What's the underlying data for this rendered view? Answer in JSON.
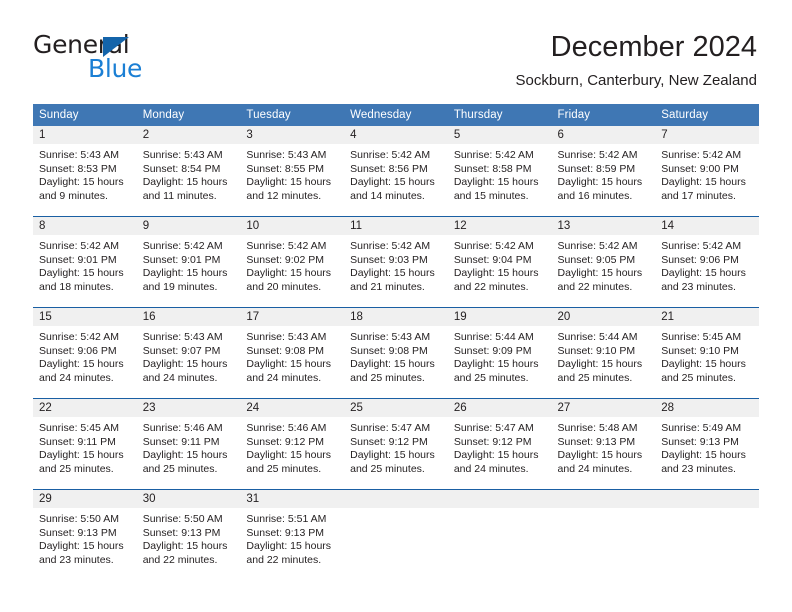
{
  "brand": {
    "name_part1": "General",
    "name_part2": "Blue",
    "logo_triangle": "blue-triangle-icon",
    "accent_color": "#1b7fd4",
    "dark_color": "#231f20"
  },
  "header": {
    "title": "December 2024",
    "subtitle": "Sockburn, Canterbury, New Zealand"
  },
  "calendar": {
    "header_bg_color": "#3f77b4",
    "row_rule_color": "#1a5fa3",
    "daynum_bg_color": "#f0f0f0",
    "weekday_headers": [
      "Sunday",
      "Monday",
      "Tuesday",
      "Wednesday",
      "Thursday",
      "Friday",
      "Saturday"
    ],
    "weeks": [
      [
        {
          "day": "1",
          "sunrise": "Sunrise: 5:43 AM",
          "sunset": "Sunset: 8:53 PM",
          "daylight_line1": "Daylight: 15 hours",
          "daylight_line2": "and 9 minutes."
        },
        {
          "day": "2",
          "sunrise": "Sunrise: 5:43 AM",
          "sunset": "Sunset: 8:54 PM",
          "daylight_line1": "Daylight: 15 hours",
          "daylight_line2": "and 11 minutes."
        },
        {
          "day": "3",
          "sunrise": "Sunrise: 5:43 AM",
          "sunset": "Sunset: 8:55 PM",
          "daylight_line1": "Daylight: 15 hours",
          "daylight_line2": "and 12 minutes."
        },
        {
          "day": "4",
          "sunrise": "Sunrise: 5:42 AM",
          "sunset": "Sunset: 8:56 PM",
          "daylight_line1": "Daylight: 15 hours",
          "daylight_line2": "and 14 minutes."
        },
        {
          "day": "5",
          "sunrise": "Sunrise: 5:42 AM",
          "sunset": "Sunset: 8:58 PM",
          "daylight_line1": "Daylight: 15 hours",
          "daylight_line2": "and 15 minutes."
        },
        {
          "day": "6",
          "sunrise": "Sunrise: 5:42 AM",
          "sunset": "Sunset: 8:59 PM",
          "daylight_line1": "Daylight: 15 hours",
          "daylight_line2": "and 16 minutes."
        },
        {
          "day": "7",
          "sunrise": "Sunrise: 5:42 AM",
          "sunset": "Sunset: 9:00 PM",
          "daylight_line1": "Daylight: 15 hours",
          "daylight_line2": "and 17 minutes."
        }
      ],
      [
        {
          "day": "8",
          "sunrise": "Sunrise: 5:42 AM",
          "sunset": "Sunset: 9:01 PM",
          "daylight_line1": "Daylight: 15 hours",
          "daylight_line2": "and 18 minutes."
        },
        {
          "day": "9",
          "sunrise": "Sunrise: 5:42 AM",
          "sunset": "Sunset: 9:01 PM",
          "daylight_line1": "Daylight: 15 hours",
          "daylight_line2": "and 19 minutes."
        },
        {
          "day": "10",
          "sunrise": "Sunrise: 5:42 AM",
          "sunset": "Sunset: 9:02 PM",
          "daylight_line1": "Daylight: 15 hours",
          "daylight_line2": "and 20 minutes."
        },
        {
          "day": "11",
          "sunrise": "Sunrise: 5:42 AM",
          "sunset": "Sunset: 9:03 PM",
          "daylight_line1": "Daylight: 15 hours",
          "daylight_line2": "and 21 minutes."
        },
        {
          "day": "12",
          "sunrise": "Sunrise: 5:42 AM",
          "sunset": "Sunset: 9:04 PM",
          "daylight_line1": "Daylight: 15 hours",
          "daylight_line2": "and 22 minutes."
        },
        {
          "day": "13",
          "sunrise": "Sunrise: 5:42 AM",
          "sunset": "Sunset: 9:05 PM",
          "daylight_line1": "Daylight: 15 hours",
          "daylight_line2": "and 22 minutes."
        },
        {
          "day": "14",
          "sunrise": "Sunrise: 5:42 AM",
          "sunset": "Sunset: 9:06 PM",
          "daylight_line1": "Daylight: 15 hours",
          "daylight_line2": "and 23 minutes."
        }
      ],
      [
        {
          "day": "15",
          "sunrise": "Sunrise: 5:42 AM",
          "sunset": "Sunset: 9:06 PM",
          "daylight_line1": "Daylight: 15 hours",
          "daylight_line2": "and 24 minutes."
        },
        {
          "day": "16",
          "sunrise": "Sunrise: 5:43 AM",
          "sunset": "Sunset: 9:07 PM",
          "daylight_line1": "Daylight: 15 hours",
          "daylight_line2": "and 24 minutes."
        },
        {
          "day": "17",
          "sunrise": "Sunrise: 5:43 AM",
          "sunset": "Sunset: 9:08 PM",
          "daylight_line1": "Daylight: 15 hours",
          "daylight_line2": "and 24 minutes."
        },
        {
          "day": "18",
          "sunrise": "Sunrise: 5:43 AM",
          "sunset": "Sunset: 9:08 PM",
          "daylight_line1": "Daylight: 15 hours",
          "daylight_line2": "and 25 minutes."
        },
        {
          "day": "19",
          "sunrise": "Sunrise: 5:44 AM",
          "sunset": "Sunset: 9:09 PM",
          "daylight_line1": "Daylight: 15 hours",
          "daylight_line2": "and 25 minutes."
        },
        {
          "day": "20",
          "sunrise": "Sunrise: 5:44 AM",
          "sunset": "Sunset: 9:10 PM",
          "daylight_line1": "Daylight: 15 hours",
          "daylight_line2": "and 25 minutes."
        },
        {
          "day": "21",
          "sunrise": "Sunrise: 5:45 AM",
          "sunset": "Sunset: 9:10 PM",
          "daylight_line1": "Daylight: 15 hours",
          "daylight_line2": "and 25 minutes."
        }
      ],
      [
        {
          "day": "22",
          "sunrise": "Sunrise: 5:45 AM",
          "sunset": "Sunset: 9:11 PM",
          "daylight_line1": "Daylight: 15 hours",
          "daylight_line2": "and 25 minutes."
        },
        {
          "day": "23",
          "sunrise": "Sunrise: 5:46 AM",
          "sunset": "Sunset: 9:11 PM",
          "daylight_line1": "Daylight: 15 hours",
          "daylight_line2": "and 25 minutes."
        },
        {
          "day": "24",
          "sunrise": "Sunrise: 5:46 AM",
          "sunset": "Sunset: 9:12 PM",
          "daylight_line1": "Daylight: 15 hours",
          "daylight_line2": "and 25 minutes."
        },
        {
          "day": "25",
          "sunrise": "Sunrise: 5:47 AM",
          "sunset": "Sunset: 9:12 PM",
          "daylight_line1": "Daylight: 15 hours",
          "daylight_line2": "and 25 minutes."
        },
        {
          "day": "26",
          "sunrise": "Sunrise: 5:47 AM",
          "sunset": "Sunset: 9:12 PM",
          "daylight_line1": "Daylight: 15 hours",
          "daylight_line2": "and 24 minutes."
        },
        {
          "day": "27",
          "sunrise": "Sunrise: 5:48 AM",
          "sunset": "Sunset: 9:13 PM",
          "daylight_line1": "Daylight: 15 hours",
          "daylight_line2": "and 24 minutes."
        },
        {
          "day": "28",
          "sunrise": "Sunrise: 5:49 AM",
          "sunset": "Sunset: 9:13 PM",
          "daylight_line1": "Daylight: 15 hours",
          "daylight_line2": "and 23 minutes."
        }
      ],
      [
        {
          "day": "29",
          "sunrise": "Sunrise: 5:50 AM",
          "sunset": "Sunset: 9:13 PM",
          "daylight_line1": "Daylight: 15 hours",
          "daylight_line2": "and 23 minutes."
        },
        {
          "day": "30",
          "sunrise": "Sunrise: 5:50 AM",
          "sunset": "Sunset: 9:13 PM",
          "daylight_line1": "Daylight: 15 hours",
          "daylight_line2": "and 22 minutes."
        },
        {
          "day": "31",
          "sunrise": "Sunrise: 5:51 AM",
          "sunset": "Sunset: 9:13 PM",
          "daylight_line1": "Daylight: 15 hours",
          "daylight_line2": "and 22 minutes."
        },
        {
          "day": "",
          "sunrise": "",
          "sunset": "",
          "daylight_line1": "",
          "daylight_line2": ""
        },
        {
          "day": "",
          "sunrise": "",
          "sunset": "",
          "daylight_line1": "",
          "daylight_line2": ""
        },
        {
          "day": "",
          "sunrise": "",
          "sunset": "",
          "daylight_line1": "",
          "daylight_line2": ""
        },
        {
          "day": "",
          "sunrise": "",
          "sunset": "",
          "daylight_line1": "",
          "daylight_line2": ""
        }
      ]
    ]
  }
}
